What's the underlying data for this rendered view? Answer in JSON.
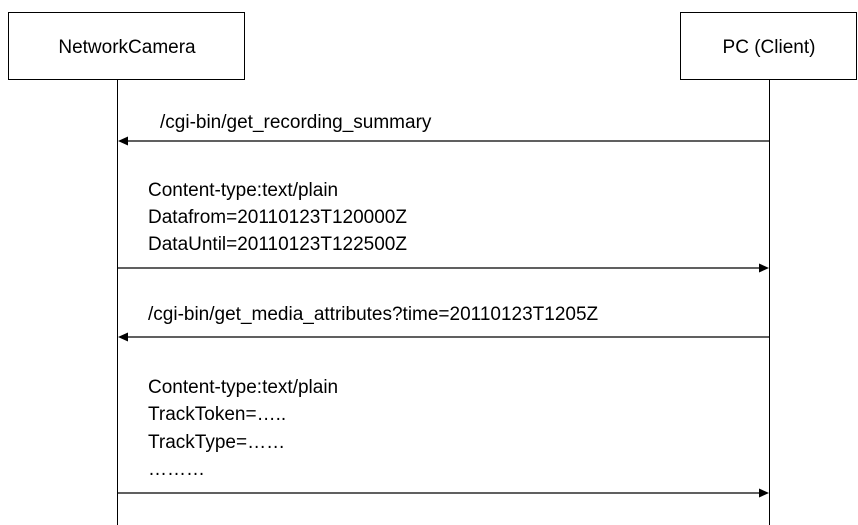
{
  "participants": {
    "camera": "NetworkCamera",
    "client": "PC (Client)"
  },
  "messages": [
    {
      "direction": "client-to-camera",
      "lines": [
        "/cgi-bin/get_recording_summary"
      ]
    },
    {
      "direction": "camera-to-client",
      "lines": [
        "Content-type:text/plain",
        "Datafrom=20110123T120000Z",
        "DataUntil=20110123T122500Z"
      ]
    },
    {
      "direction": "client-to-camera",
      "lines": [
        "/cgi-bin/get_media_attributes?time=20110123T1205Z"
      ]
    },
    {
      "direction": "camera-to-client",
      "lines": [
        "Content-type:text/plain",
        "TrackToken=…..",
        "TrackType=……",
        "………"
      ]
    }
  ]
}
